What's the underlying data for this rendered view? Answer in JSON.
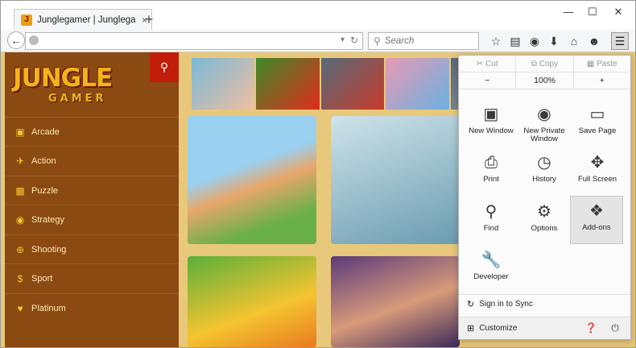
{
  "browser": {
    "tab_title": "Junglegamer | Junglegam...",
    "tab_close": "×",
    "new_tab": "+",
    "search_placeholder": "Search",
    "window_min": "—",
    "window_max": "☐",
    "window_close": "✕"
  },
  "site": {
    "logo_line1": "JUNGLE",
    "logo_line2": "GAMER",
    "categories": [
      {
        "label": "Arcade",
        "icon": "gamepad-icon"
      },
      {
        "label": "Action",
        "icon": "plane-icon"
      },
      {
        "label": "Puzzle",
        "icon": "image-icon"
      },
      {
        "label": "Strategy",
        "icon": "globe-icon"
      },
      {
        "label": "Shooting",
        "icon": "crosshair-icon"
      },
      {
        "label": "Sport",
        "icon": "dollar-icon"
      },
      {
        "label": "Platinum",
        "icon": "heart-icon"
      }
    ]
  },
  "menu": {
    "cut": "Cut",
    "copy": "Copy",
    "paste": "Paste",
    "zoom_out": "−",
    "zoom_level": "100%",
    "zoom_in": "+",
    "buttons": [
      {
        "label": "New Window",
        "icon": "window-icon"
      },
      {
        "label": "New Private Window",
        "icon": "mask-icon"
      },
      {
        "label": "Save Page",
        "icon": "page-icon"
      },
      {
        "label": "Print",
        "icon": "printer-icon"
      },
      {
        "label": "History",
        "icon": "clock-icon"
      },
      {
        "label": "Full Screen",
        "icon": "fullscreen-icon"
      },
      {
        "label": "Find",
        "icon": "magnifier-icon"
      },
      {
        "label": "Options",
        "icon": "gear-icon"
      },
      {
        "label": "Add-ons",
        "icon": "puzzle-icon"
      },
      {
        "label": "Developer",
        "icon": "wrench-icon"
      }
    ],
    "sign_in": "Sign in to Sync",
    "customize": "Customize"
  }
}
